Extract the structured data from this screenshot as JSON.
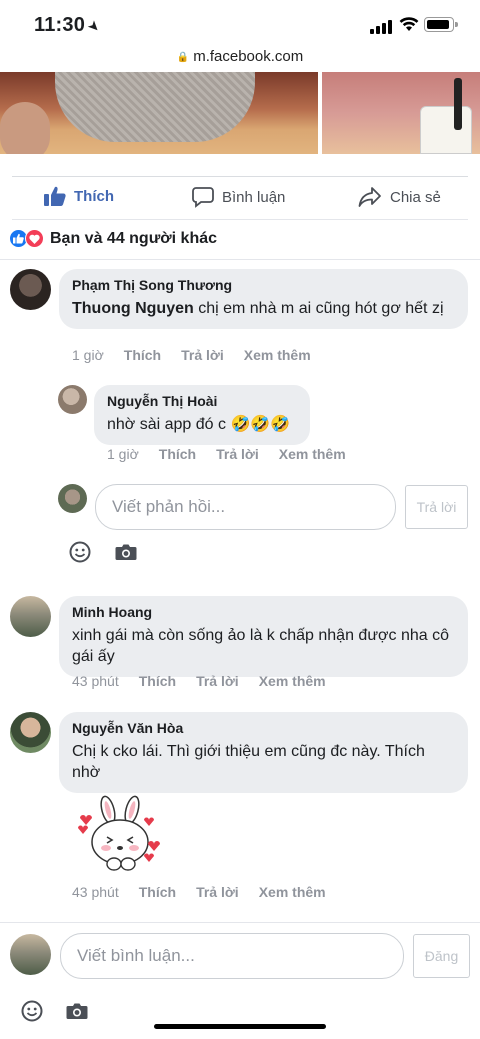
{
  "status": {
    "time": "11:30",
    "url": "m.facebook.com"
  },
  "actions": {
    "like": "Thích",
    "comment": "Bình luận",
    "share": "Chia sẻ"
  },
  "reactions": {
    "text": "Bạn và 44 người khác"
  },
  "comments": [
    {
      "author": "Phạm Thị Song Thương",
      "mention": "Thuong Nguyen",
      "text": " chị em nhà m ai cũng hót gơ hết zị",
      "time": "1 giờ",
      "like": "Thích",
      "reply": "Trả lời",
      "more": "Xem thêm"
    },
    {
      "author": "Minh Hoang",
      "text": "xinh gái mà còn sống ảo là k chấp nhận được nha cô gái ấy",
      "time": "43 phút",
      "like": "Thích",
      "reply": "Trả lời",
      "more": "Xem thêm"
    },
    {
      "author": "Nguyễn Văn Hòa",
      "text": "Chị k cko lái. Thì giới thiệu em cũng đc này. Thích nhờ",
      "time": "43 phút",
      "like": "Thích",
      "reply": "Trả lời",
      "more": "Xem thêm"
    }
  ],
  "reply": {
    "author": "Nguyễn Thị Hoài",
    "text": "nhờ sài app đó c 🤣🤣🤣",
    "time": "1 giờ",
    "like": "Thích",
    "reply": "Trả lời",
    "more": "Xem thêm"
  },
  "reply_box": {
    "placeholder": "Viết phản hồi...",
    "button": "Trả lời"
  },
  "comment_box": {
    "placeholder": "Viết bình luận...",
    "button": "Đăng"
  },
  "colors": {
    "fb_blue": "#4267b2",
    "bubble": "#ebedf0",
    "meta": "#90949c"
  }
}
